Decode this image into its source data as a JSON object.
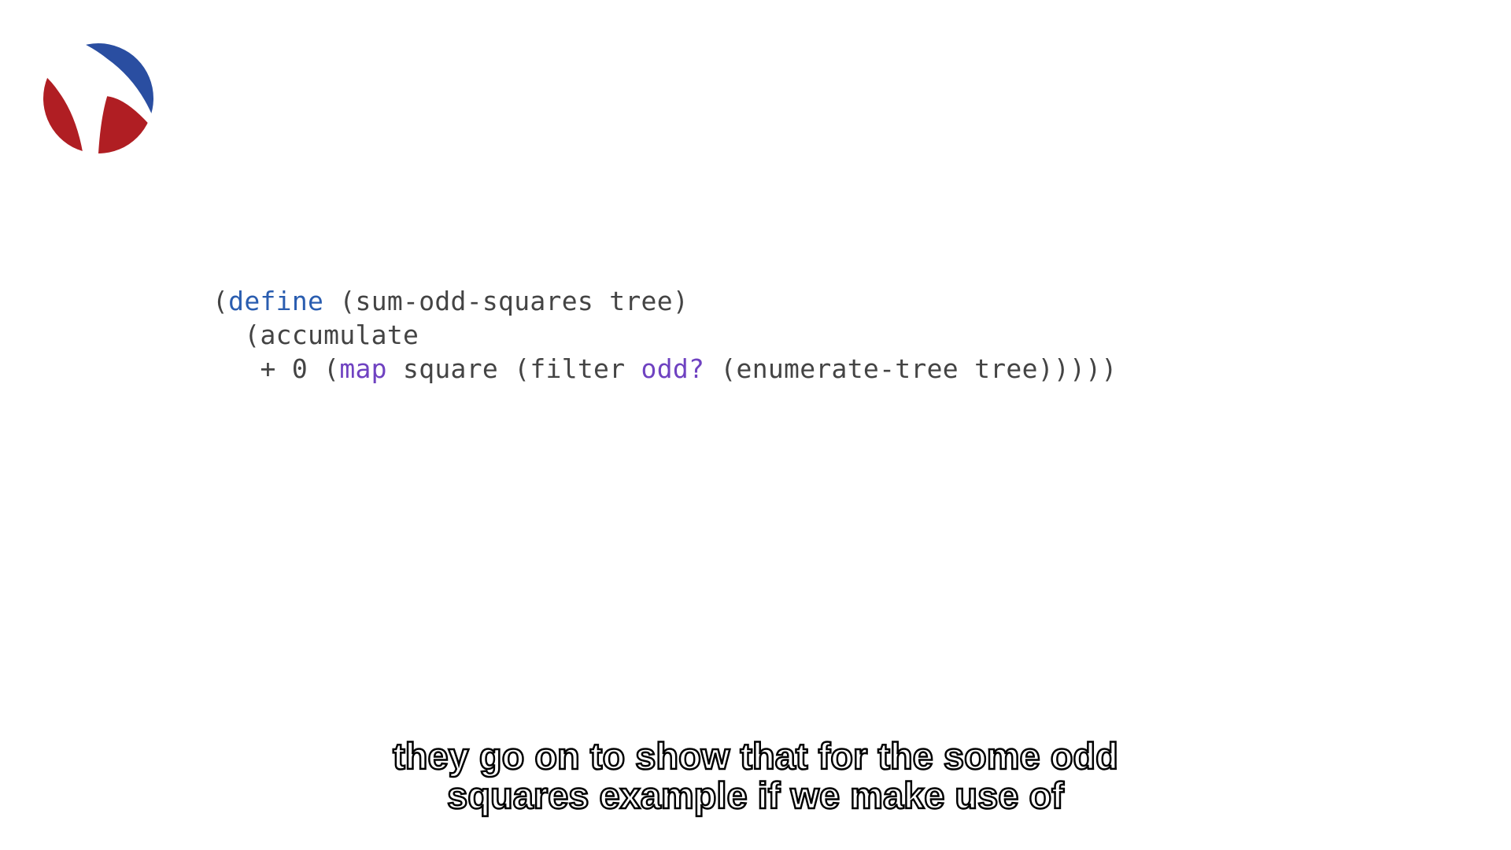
{
  "colors": {
    "logo_red": "#b01e23",
    "logo_blue": "#2a4ea1",
    "kw_define": "#2a5db0",
    "kw_fn": "#6f42c1",
    "code_text": "#444444"
  },
  "code": {
    "t1a": "(",
    "t1b": "define",
    "t1c": " (sum-odd-squares tree)",
    "t2": "  (accumulate",
    "t3a": "   + 0 (",
    "t3b": "map",
    "t3c": " square (filter ",
    "t3d": "odd?",
    "t3e": " (enumerate-tree tree)))))"
  },
  "subtitle": {
    "line1": "they go on to show that for the some odd",
    "line2": "squares example if we make use of"
  }
}
